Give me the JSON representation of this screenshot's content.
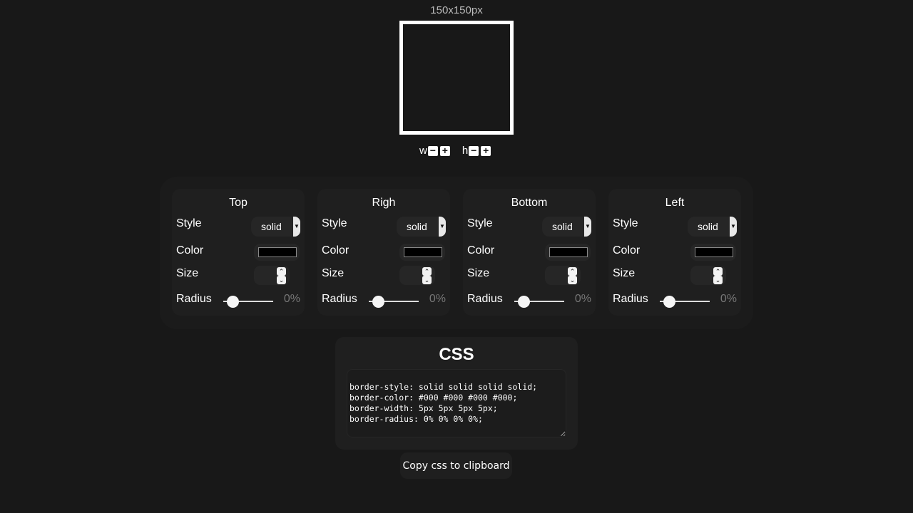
{
  "preview": {
    "dimensions": "150x150px",
    "border_color": "#ffffff",
    "w_label": "w",
    "h_label": "h",
    "minus": "−",
    "plus": "+"
  },
  "labels": {
    "style": "Style",
    "color": "Color",
    "size": "Size",
    "radius": "Radius"
  },
  "panels": [
    {
      "title": "Top",
      "style": "solid",
      "color": "#000000",
      "size": "",
      "radius": "0%",
      "radius_value": 0
    },
    {
      "title": "Righ",
      "style": "solid",
      "color": "#000000",
      "size": "",
      "radius": "0%",
      "radius_value": 0
    },
    {
      "title": "Bottom",
      "style": "solid",
      "color": "#000000",
      "size": "",
      "radius": "0%",
      "radius_value": 0
    },
    {
      "title": "Left",
      "style": "solid",
      "color": "#000000",
      "size": "",
      "radius": "0%",
      "radius_value": 0
    }
  ],
  "css": {
    "title": "CSS",
    "code": "border-style: solid solid solid solid;\nborder-color: #000 #000 #000 #000;\nborder-width: 5px 5px 5px 5px;\nborder-radius: 0% 0% 0% 0%;"
  },
  "copy_button": "Copy css to clipboard"
}
